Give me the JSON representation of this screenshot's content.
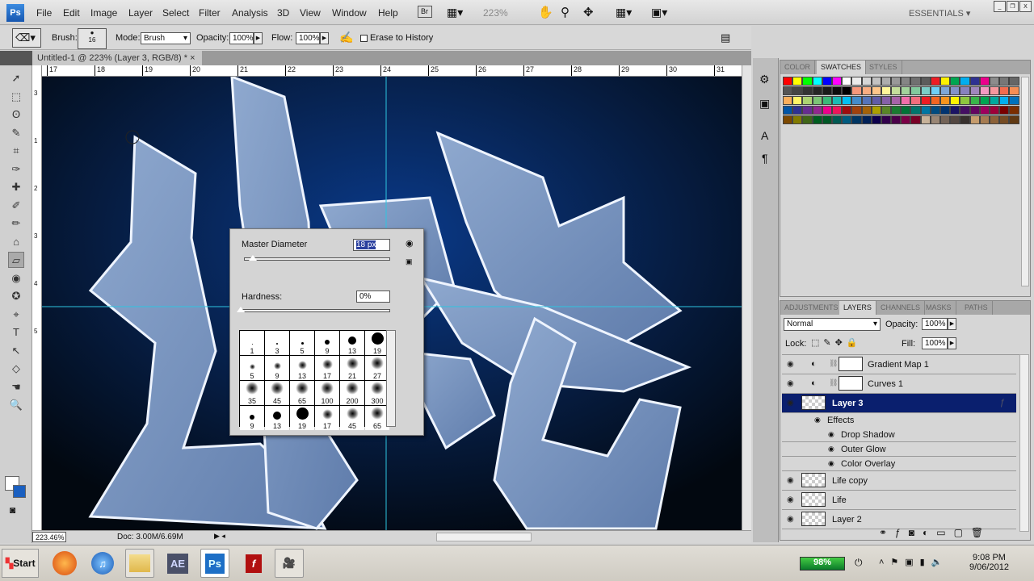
{
  "app": {
    "logo": "Ps",
    "menu": [
      "File",
      "Edit",
      "Image",
      "Layer",
      "Select",
      "Filter",
      "Analysis",
      "3D",
      "View",
      "Window",
      "Help"
    ],
    "bridge": "Br",
    "zoom": "223%",
    "workspace": "ESSENTIALS"
  },
  "options": {
    "brush_label": "Brush:",
    "brush_size": "16",
    "mode_label": "Mode:",
    "mode_value": "Brush",
    "opacity_label": "Opacity:",
    "opacity_value": "100%",
    "flow_label": "Flow:",
    "flow_value": "100%",
    "erase_history": "Erase to History"
  },
  "document": {
    "tab_title": "Untitled-1 @ 223% (Layer 3, RGB/8) *",
    "close": "×",
    "ruler_h": [
      "17",
      "18",
      "19",
      "20",
      "21",
      "22",
      "23",
      "24",
      "25",
      "26",
      "27",
      "28",
      "29",
      "30",
      "31"
    ],
    "ruler_v": [
      "3",
      "1",
      "2",
      "3",
      "4",
      "5"
    ],
    "zoom_status": "223.46%",
    "doc_status": "Doc: 3.00M/6.69M"
  },
  "tools": [
    "➚",
    "⬚",
    "ʘ",
    "✎",
    "⌗",
    "✑",
    "✚",
    "✐",
    "✏",
    "⌂",
    "▱",
    "◉",
    "✪",
    "⌖",
    "T",
    "↖",
    "◇",
    "☚",
    "🔍"
  ],
  "swatches_panel": {
    "tabs": [
      "COLOR",
      "SWATCHES",
      "STYLES"
    ],
    "active": "SWATCHES",
    "colors": [
      "#ff0000",
      "#ffff00",
      "#00ff00",
      "#00ffff",
      "#0000ff",
      "#ff00ff",
      "#ffffff",
      "#ebebeb",
      "#d6d6d6",
      "#c2c2c2",
      "#adadad",
      "#999999",
      "#858585",
      "#707070",
      "#5c5c5c",
      "#ed1c24",
      "#fff200",
      "#00a651",
      "#00aeef",
      "#2e3192",
      "#ec008c",
      "#8c8c8c",
      "#777777",
      "#666666",
      "#555555",
      "#444444",
      "#333333",
      "#262626",
      "#1a1a1a",
      "#0d0d0d",
      "#000000",
      "#f7977a",
      "#f9ad81",
      "#fdc68a",
      "#fff79a",
      "#c4df9b",
      "#a2d39c",
      "#82ca9d",
      "#7bcdc8",
      "#6ecff6",
      "#7ea7d8",
      "#8493ca",
      "#8882be",
      "#a187be",
      "#f49ac2",
      "#f6989d",
      "#f26c4f",
      "#f68e55",
      "#fbaf5c",
      "#fff467",
      "#acd372",
      "#7cc576",
      "#3bb878",
      "#1abbb4",
      "#00bff3",
      "#438ccb",
      "#5574b9",
      "#605ca8",
      "#8560a8",
      "#a763a8",
      "#f06eaa",
      "#f26d7d",
      "#ed1c24",
      "#f26522",
      "#f7941d",
      "#fff200",
      "#8dc73f",
      "#39b54a",
      "#00a651",
      "#00a99d",
      "#00aeef",
      "#0072bc",
      "#0054a6",
      "#2e3192",
      "#662d91",
      "#92278f",
      "#ec008c",
      "#ed145b",
      "#9e0b0f",
      "#a0410d",
      "#a36209",
      "#aba000",
      "#598527",
      "#197b30",
      "#007236",
      "#00746b",
      "#0076a3",
      "#004b80",
      "#003471",
      "#1b1464",
      "#440e62",
      "#630460",
      "#9e005d",
      "#9e0039",
      "#790000",
      "#7b2e00",
      "#7d4900",
      "#827b00",
      "#406618",
      "#005e20",
      "#005826",
      "#005952",
      "#005b7f",
      "#003663",
      "#002157",
      "#0d004c",
      "#32004b",
      "#4b0049",
      "#7b0046",
      "#7a0026",
      "#c7b299",
      "#998675",
      "#736357",
      "#534741",
      "#37302d",
      "#c69c6d",
      "#a67c52",
      "#8c6239",
      "#754c24",
      "#603913"
    ]
  },
  "layers_panel": {
    "tabs": [
      "ADJUSTMENTS",
      "LAYERS",
      "CHANNELS",
      "MASKS",
      "PATHS"
    ],
    "active": "LAYERS",
    "blend_mode": "Normal",
    "opacity_label": "Opacity:",
    "opacity_value": "100%",
    "lock_label": "Lock:",
    "fill_label": "Fill:",
    "fill_value": "100%",
    "layers": [
      {
        "name": "Gradient Map 1",
        "type": "adjustment"
      },
      {
        "name": "Curves 1",
        "type": "adjustment"
      },
      {
        "name": "Layer 3",
        "type": "pixel",
        "selected": true
      }
    ],
    "effects_label": "Effects",
    "effects": [
      "Drop Shadow",
      "Outer Glow",
      "Color Overlay"
    ],
    "layers_below": [
      {
        "name": "Life copy"
      },
      {
        "name": "Life"
      },
      {
        "name": "Layer 2"
      }
    ]
  },
  "brush_dialog": {
    "master_label": "Master Diameter",
    "master_value": "18 px",
    "master_fraction": 0.06,
    "hardness_label": "Hardness:",
    "hardness_value": "0%",
    "hardness_fraction": 0,
    "presets": [
      {
        "s": "1",
        "d": 1,
        "soft": false
      },
      {
        "s": "3",
        "d": 2,
        "soft": false
      },
      {
        "s": "5",
        "d": 3,
        "soft": false
      },
      {
        "s": "9",
        "d": 6,
        "soft": false
      },
      {
        "s": "13",
        "d": 10,
        "soft": false
      },
      {
        "s": "19",
        "d": 15,
        "soft": false
      },
      {
        "s": "5",
        "d": 3,
        "soft": true
      },
      {
        "s": "9",
        "d": 5,
        "soft": true
      },
      {
        "s": "13",
        "d": 7,
        "soft": true
      },
      {
        "s": "17",
        "d": 9,
        "soft": true
      },
      {
        "s": "21",
        "d": 11,
        "soft": true
      },
      {
        "s": "27",
        "d": 12,
        "soft": true
      },
      {
        "s": "35",
        "d": 12,
        "soft": true
      },
      {
        "s": "45",
        "d": 12,
        "soft": true
      },
      {
        "s": "65",
        "d": 12,
        "soft": true
      },
      {
        "s": "100",
        "d": 12,
        "soft": true
      },
      {
        "s": "200",
        "d": 12,
        "soft": true
      },
      {
        "s": "300",
        "d": 12,
        "soft": true
      },
      {
        "s": "9",
        "d": 6,
        "soft": false
      },
      {
        "s": "13",
        "d": 10,
        "soft": false
      },
      {
        "s": "19",
        "d": 15,
        "soft": false
      },
      {
        "s": "17",
        "d": 9,
        "soft": true
      },
      {
        "s": "45",
        "d": 11,
        "soft": true
      },
      {
        "s": "65",
        "d": 12,
        "soft": true
      }
    ]
  },
  "taskbar": {
    "start": "Start",
    "apps": [
      "firefox",
      "itunes",
      "explorer",
      "AE",
      "Ps",
      "flash",
      "camera"
    ],
    "battery": "98%",
    "time": "9:08 PM",
    "date": "9/06/2012"
  }
}
